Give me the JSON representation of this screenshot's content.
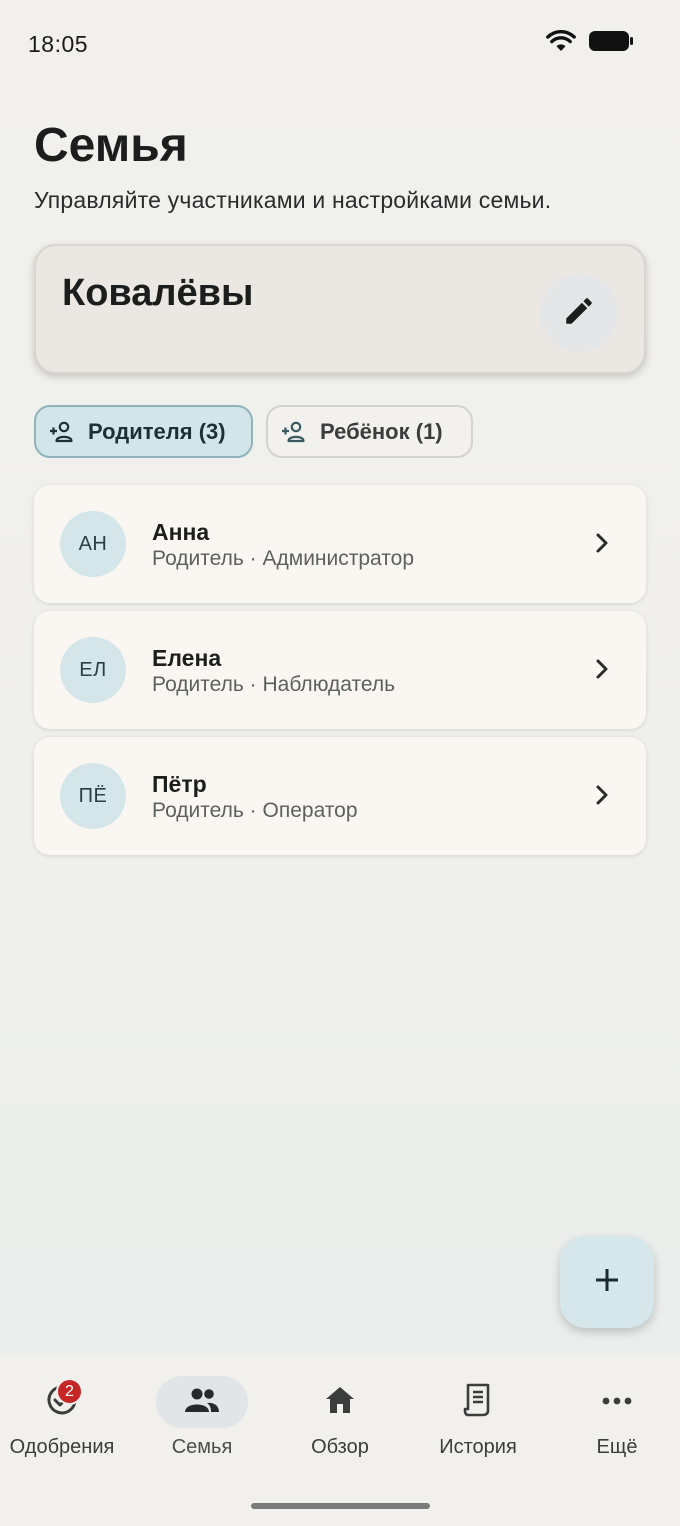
{
  "status_bar": {
    "time": "18:05",
    "wifi_icon": "wifi-icon",
    "battery_icon": "battery-icon"
  },
  "header": {
    "title": "Семья",
    "subtitle": "Управляйте участниками и настройками семьи."
  },
  "family_card": {
    "name": "Ковалёвы",
    "edit_icon": "pencil-icon"
  },
  "filters": [
    {
      "label": "Родителя (3)",
      "icon": "add-person-icon",
      "selected": true
    },
    {
      "label": "Ребёнок (1)",
      "icon": "add-person-icon",
      "selected": false
    }
  ],
  "members": [
    {
      "initials": "АН",
      "name": "Анна",
      "role": "Родитель · Администратор"
    },
    {
      "initials": "ЕЛ",
      "name": "Елена",
      "role": "Родитель · Наблюдатель"
    },
    {
      "initials": "ПЁ",
      "name": "Пётр",
      "role": "Родитель · Оператор"
    }
  ],
  "fab": {
    "icon": "plus-icon"
  },
  "bottom_nav": [
    {
      "label": "Одобрения",
      "icon": "check-circle-icon",
      "badge": "2",
      "active": false
    },
    {
      "label": "Семья",
      "icon": "people-icon",
      "active": true
    },
    {
      "label": "Обзор",
      "icon": "home-icon",
      "active": false
    },
    {
      "label": "История",
      "icon": "receipt-icon",
      "active": false
    },
    {
      "label": "Ещё",
      "icon": "more-icon",
      "active": false
    }
  ],
  "colors": {
    "accent": "#d2e6ea",
    "accent_border": "#8fb3bb",
    "badge": "#c52727"
  }
}
